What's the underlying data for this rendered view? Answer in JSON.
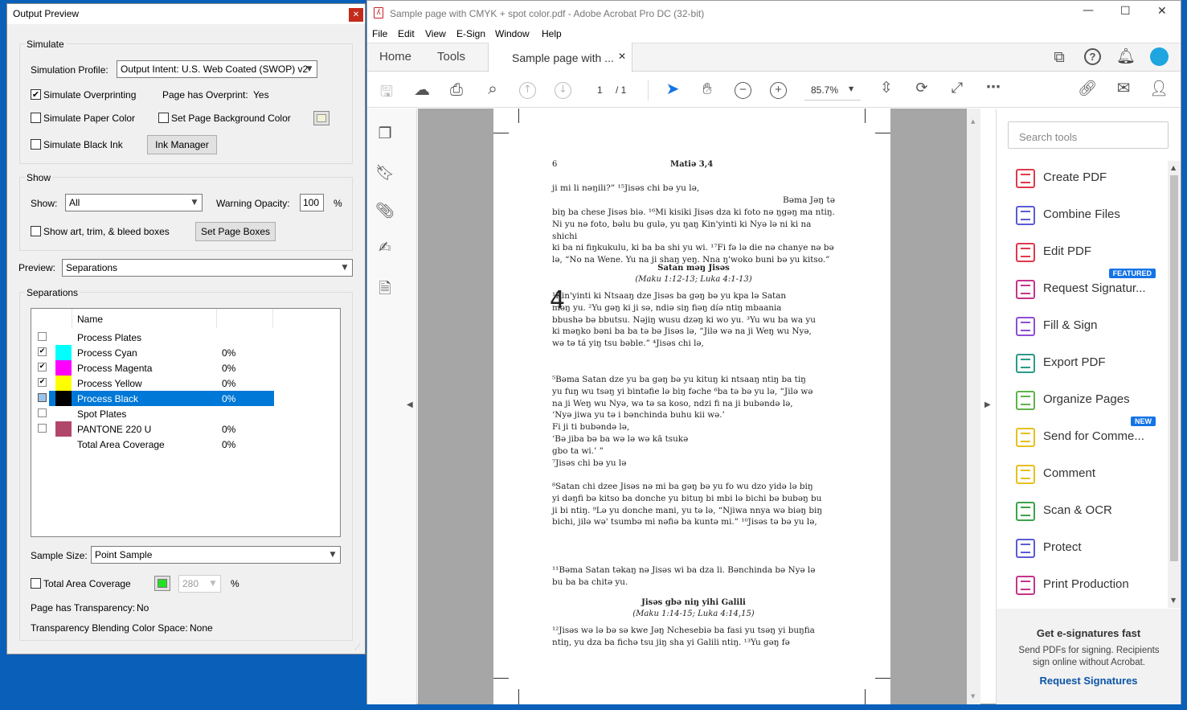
{
  "output_preview": {
    "title": "Output Preview",
    "simulate_group": "Simulate",
    "simulation_profile_label": "Simulation Profile:",
    "simulation_profile_value": "Output Intent: U.S. Web Coated (SWOP) v2",
    "simulate_overprinting": "Simulate Overprinting",
    "page_has_overprint_label": "Page has Overprint:",
    "page_has_overprint_value": "Yes",
    "simulate_paper_color": "Simulate Paper Color",
    "set_page_bg_color": "Set Page Background Color",
    "simulate_black_ink": "Simulate Black Ink",
    "ink_manager": "Ink Manager",
    "show_group": "Show",
    "show_label": "Show:",
    "show_value": "All",
    "warning_opacity_label": "Warning Opacity:",
    "warning_opacity_value": "100",
    "percent": "%",
    "show_boxes": "Show art, trim, & bleed boxes",
    "set_page_boxes": "Set Page Boxes",
    "preview_label": "Preview:",
    "preview_value": "Separations",
    "separations_group": "Separations",
    "col_name": "Name",
    "rows": [
      {
        "name": "Process Plates",
        "value": "",
        "color": "",
        "checked": false,
        "selected": false
      },
      {
        "name": "Process Cyan",
        "value": "0%",
        "color": "#00ffff",
        "checked": true,
        "selected": false
      },
      {
        "name": "Process Magenta",
        "value": "0%",
        "color": "#ff00ff",
        "checked": true,
        "selected": false
      },
      {
        "name": "Process Yellow",
        "value": "0%",
        "color": "#ffff00",
        "checked": true,
        "selected": false
      },
      {
        "name": "Process Black",
        "value": "0%",
        "color": "#000000",
        "checked": true,
        "selected": true
      },
      {
        "name": "Spot Plates",
        "value": "",
        "color": "",
        "checked": false,
        "selected": false
      },
      {
        "name": "PANTONE 220 U",
        "value": "0%",
        "color": "#b0476b",
        "checked": false,
        "selected": false
      },
      {
        "name": "Total Area Coverage",
        "value": "0%",
        "color": "",
        "checked": false,
        "selected": false
      }
    ],
    "sample_size_label": "Sample Size:",
    "sample_size_value": "Point Sample",
    "total_area_coverage": "Total Area Coverage",
    "tac_value": "280",
    "page_has_transparency_label": "Page has Transparency:",
    "page_has_transparency_value": "No",
    "transparency_blending_label": "Transparency Blending Color Space:",
    "transparency_blending_value": "None"
  },
  "acrobat": {
    "title": "Sample page with CMYK + spot color.pdf - Adobe Acrobat Pro DC (32-bit)",
    "menu": [
      "File",
      "Edit",
      "View",
      "E-Sign",
      "Window",
      "Help"
    ],
    "tab_home": "Home",
    "tab_tools": "Tools",
    "doc_tab": "Sample page with ...",
    "page_current": "1",
    "page_total": "/ 1",
    "zoom": "85.7%",
    "search_tools_placeholder": "Search tools",
    "tools": [
      {
        "label": "Create PDF",
        "color": "#e0394a",
        "badge": ""
      },
      {
        "label": "Combine Files",
        "color": "#5b5bd6",
        "badge": ""
      },
      {
        "label": "Edit PDF",
        "color": "#e0394a",
        "badge": ""
      },
      {
        "label": "Request Signatur...",
        "color": "#c6348a",
        "badge": "FEATURED"
      },
      {
        "label": "Fill & Sign",
        "color": "#8c4fd6",
        "badge": ""
      },
      {
        "label": "Export PDF",
        "color": "#2d9a8a",
        "badge": ""
      },
      {
        "label": "Organize Pages",
        "color": "#5fb34a",
        "badge": ""
      },
      {
        "label": "Send for Comme...",
        "color": "#e6c01e",
        "badge": "NEW"
      },
      {
        "label": "Comment",
        "color": "#e6c01e",
        "badge": ""
      },
      {
        "label": "Scan & OCR",
        "color": "#3ca34a",
        "badge": ""
      },
      {
        "label": "Protect",
        "color": "#5b5bd6",
        "badge": ""
      },
      {
        "label": "Print Production",
        "color": "#c6348a",
        "badge": ""
      }
    ],
    "promo_title": "Get e-signatures fast",
    "promo_text": "Send PDFs for signing. Recipients sign online without Acrobat.",
    "promo_link": "Request Signatures"
  },
  "document": {
    "page_number": "6",
    "running_head": "Matiə 3,4",
    "p1": "ji mi li nəŋili?” ¹⁵Jisəs chi bə yu lə,",
    "p2": "Bəma Jəŋ tə",
    "p3": "biŋ ba chese Jisəs biə. ¹⁶Mi kisiki Jisəs dza ki foto nə ŋgəŋ ma ntiŋ.\nNi yu nə foto, bəlu bu gulə, yu ŋaŋ Kin'yinti ki Nyə lə ni ki na shichi\nki ba ni fiŋkukulu, ki ba ba shi yu wi. ¹⁷Fi fə lə die nə chanye nə bə\nlə, “No na Wene. Yu na ji shaŋ yeŋ. Nna ŋ'woko buni bə yu kitso.”",
    "h1": "Satan məŋ Jisəs",
    "h1ref": "(Maku 1:12-13; Luka 4:1-13)",
    "chapter": "4",
    "p4": "¹Kin'yinti ki Ntsaaŋ dze Jisəs ba gəŋ bə yu kpa lə Satan\n    məŋ yu. ²Yu gəŋ ki ji sə, ndiə siŋ fiəŋ díə ntiŋ mbaania\nbbushə bə bbutsu. Nəjiŋ wusu dzəŋ ki wo yu. ³Yu wu ba wa yu\nki məŋko bəni ba ba tə bə Jisəs lə, “Jilə wə na ji Weŋ wu Nyə,\nwə tə tá yiŋ tsu bəble.” ⁴Jisəs chi lə,",
    "p5": "   ⁵Bəma Satan dze yu ba gəŋ bə yu kituŋ ki ntsaaŋ ntiŋ ba tiŋ\nyu fuŋ wu tsəŋ yi bintəfie lə biŋ fəche ⁶ba tə bə yu lə, “Jilə wə\nna ji Weŋ wu Nyə, wə tə sa koso, ndzi fi na ji bubəndə lə,\n      ‘Nyə jiwa yu tə i bənchinda buhu kii wə.’\nFi ji ti bubəndə lə,\n      ‘Bə jiba bə ba wə lə wə kā tsukə\n      gbo ta wi.’ ”\n   ⁷Jisəs chi bə yu lə",
    "p6": "   ⁸Satan chi dzee Jisəs nə mi ba gəŋ bə yu fo wu dzo yidə lə biŋ\nyi dəŋfi bə kitso ba donche yu bituŋ bi mbi lə bichi bə bubəŋ bu\nji bi ntiŋ. ⁹Lə yu donche mani, yu tə lə, “Njiwa nnya wə biəŋ biŋ\nbichi, jilə wə' tsumbə mi nəfiə ba kuntə mi.” ¹⁰Jisəs tə bə yu lə,",
    "p7": "¹¹Bəma Satan təkaŋ nə Jisəs wi ba dza li. Bənchinda bə Nyə lə\nbu ba ba chitə yu.",
    "h2": "Jisəs gbə niŋ yihi Galili",
    "h2ref": "(Maku 1:14-15; Luka 4:14,15)",
    "p8": "   ¹²Jisəs wə lə bə sə kwe Jəŋ Nchesebiə ba fasi yu tsəŋ yi buŋfia\nntiŋ, yu dza ba fichə tsu jiŋ sha yi Galili ntiŋ. ¹³Yu gəŋ fə"
  }
}
